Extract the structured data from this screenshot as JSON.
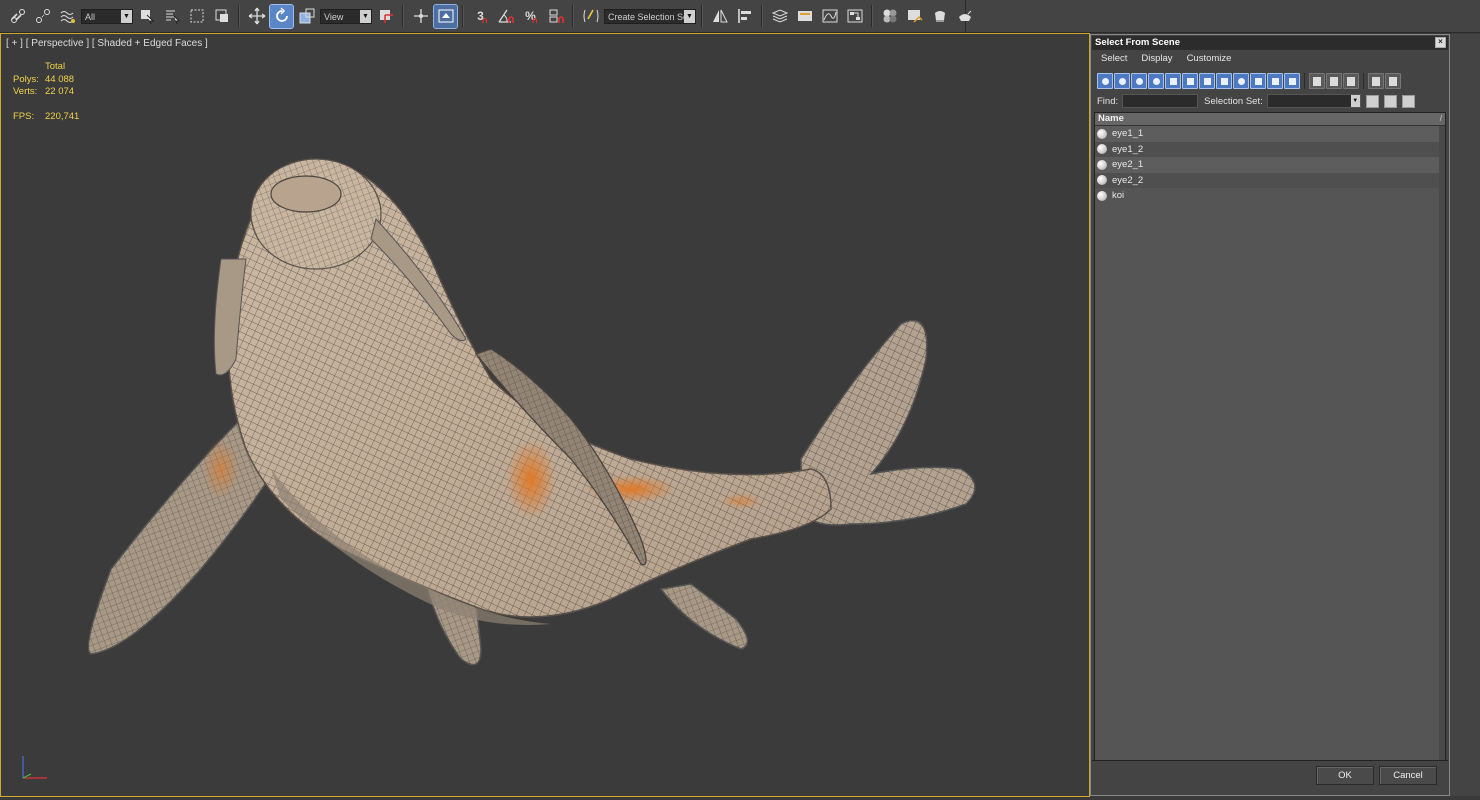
{
  "toolbar": {
    "filter_value": "All",
    "refcoord_value": "View",
    "snap_label": "3",
    "percent_label": "%",
    "named_selection_placeholder": "Create Selection Se"
  },
  "viewport": {
    "label": "[ + ] [ Perspective ] [ Shaded + Edged Faces ]",
    "stats": {
      "total_label": "Total",
      "polys_label": "Polys:",
      "polys_value": "44 088",
      "verts_label": "Verts:",
      "verts_value": "22 074",
      "fps_label": "FPS:",
      "fps_value": "220,741"
    }
  },
  "dialog": {
    "title": "Select From Scene",
    "close_glyph": "×",
    "menu": [
      "Select",
      "Display",
      "Customize"
    ],
    "find_label": "Find:",
    "selection_set_label": "Selection Set:",
    "column_name": "Name",
    "sort_glyph": "/",
    "objects": [
      "eye1_1",
      "eye1_2",
      "eye2_1",
      "eye2_2",
      "koi"
    ],
    "ok_label": "OK",
    "cancel_label": "Cancel"
  },
  "colors": {
    "accent_blue": "#5a86c8",
    "viewport_border": "#cfa830",
    "stats_yellow": "#f2d34a",
    "koi_orange": "#e07a2a"
  }
}
